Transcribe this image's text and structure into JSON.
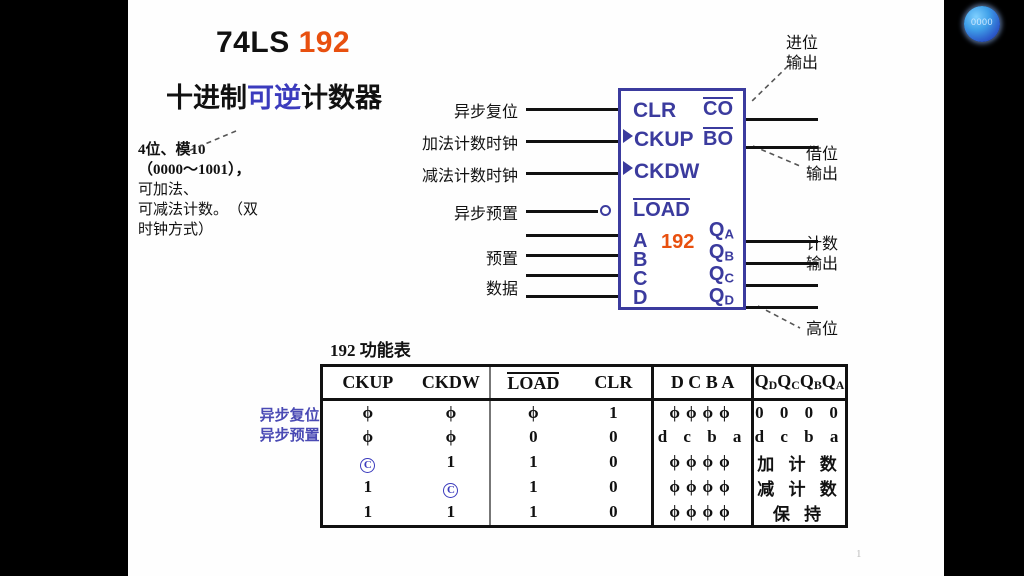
{
  "slide": {
    "logo_text": "0000",
    "page_number": "1",
    "title_main_prefix": "74LS",
    "title_main_number": "192",
    "title_sub_black1": "十进制",
    "title_sub_blue": "可逆",
    "title_sub_black2": "计数器",
    "description": [
      "4位、模10",
      "（0000～1001），",
      "可加法、",
      "可减法计数。　（双",
      "时钟方式）"
    ]
  },
  "ic": {
    "label_center": "192",
    "inputs": [
      {
        "pin": "CLR",
        "overbar": false,
        "clock": false,
        "bubble": false,
        "label": "异步复位"
      },
      {
        "pin": "CKUP",
        "overbar": false,
        "clock": true,
        "bubble": false,
        "label": "加法计数时钟"
      },
      {
        "pin": "CKDW",
        "overbar": false,
        "clock": true,
        "bubble": false,
        "label": "减法计数时钟"
      },
      {
        "pin": "LOAD",
        "overbar": true,
        "clock": false,
        "bubble": true,
        "label": "异步预置"
      },
      {
        "pin": "A",
        "overbar": false,
        "clock": false,
        "bubble": false,
        "label": ""
      },
      {
        "pin": "B",
        "overbar": false,
        "clock": false,
        "bubble": false,
        "label": "预置"
      },
      {
        "pin": "C",
        "overbar": false,
        "clock": false,
        "bubble": false,
        "label": "数据"
      },
      {
        "pin": "D",
        "overbar": false,
        "clock": false,
        "bubble": false,
        "label": ""
      }
    ],
    "outputs": [
      {
        "pin": "CO",
        "sub": "",
        "overbar": true
      },
      {
        "pin": "BO",
        "sub": "",
        "overbar": true
      },
      {
        "pin": "Q",
        "sub": "A",
        "overbar": false
      },
      {
        "pin": "Q",
        "sub": "B",
        "overbar": false
      },
      {
        "pin": "Q",
        "sub": "C",
        "overbar": false
      },
      {
        "pin": "Q",
        "sub": "D",
        "overbar": false
      }
    ],
    "right_annotations": [
      {
        "line1": "进位",
        "line2": "输出"
      },
      {
        "line1": "借位",
        "line2": "输出"
      },
      {
        "line1": "计数",
        "line2": "输出"
      },
      {
        "line1": "高位",
        "line2": ""
      }
    ]
  },
  "table": {
    "caption": "192 功能表",
    "row_labels": [
      "异步复位α",
      "异步预置α"
    ],
    "headers": {
      "ckup": "CKUP",
      "ckdw": "CKDW",
      "load": "LOAD",
      "clr": "CLR",
      "data_in": "D C B A",
      "outputs": "QDQCQBQA"
    },
    "rows": [
      {
        "ckup": "ϕ",
        "ckup_style": "plain",
        "ckdw": "ϕ",
        "ckdw_style": "plain",
        "load": "ϕ",
        "load_color": "black",
        "clr": "1",
        "clr_color": "blue",
        "data": [
          "ϕ",
          "ϕ",
          "ϕ",
          "ϕ"
        ],
        "out_text": "",
        "out": [
          "0",
          "0",
          "0",
          "0"
        ]
      },
      {
        "ckup": "ϕ",
        "ckup_style": "plain",
        "ckdw": "ϕ",
        "ckdw_style": "plain",
        "load": "0",
        "load_color": "blue",
        "clr": "0",
        "clr_color": "black",
        "data": [
          "d",
          "c",
          "b",
          "a"
        ],
        "out_text": "",
        "out": [
          "d",
          "c",
          "b",
          "a"
        ]
      },
      {
        "ckup": "©",
        "ckup_style": "circle",
        "ckdw": "1",
        "ckdw_style": "plain",
        "load": "1",
        "load_color": "black",
        "clr": "0",
        "clr_color": "black",
        "data": [
          "ϕ",
          "ϕ",
          "ϕ",
          "ϕ"
        ],
        "out_text": "加 计 数",
        "out": []
      },
      {
        "ckup": "1",
        "ckup_style": "plain",
        "ckdw": "©",
        "ckdw_style": "circle",
        "load": "1",
        "load_color": "black",
        "clr": "0",
        "clr_color": "black",
        "data": [
          "ϕ",
          "ϕ",
          "ϕ",
          "ϕ"
        ],
        "out_text": "减 计 数",
        "out": []
      },
      {
        "ckup": "1",
        "ckup_style": "plain",
        "ckdw": "1",
        "ckdw_style": "plain",
        "load": "1",
        "load_color": "black",
        "clr": "0",
        "clr_color": "black",
        "data": [
          "ϕ",
          "ϕ",
          "ϕ",
          "ϕ"
        ],
        "out_text": "保 持",
        "out": []
      }
    ]
  },
  "colors": {
    "accent_orange": "#e8500f",
    "accent_blue": "#3b3b9e",
    "text_blue": "#3b3bbd",
    "label_blue": "#4a4ab4",
    "black": "#111111",
    "slide_bg": "#fefefe",
    "letterbox": "#000000"
  }
}
